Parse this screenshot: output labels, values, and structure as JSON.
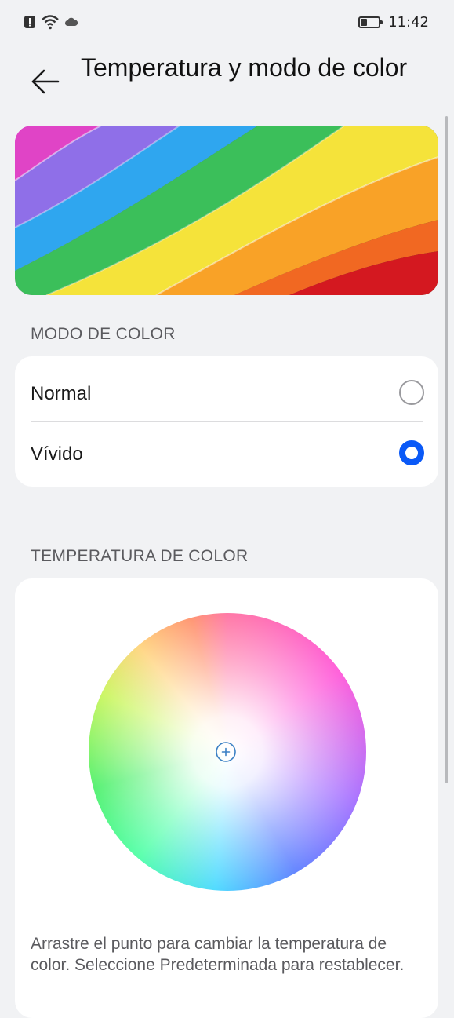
{
  "status_bar": {
    "time": "11:42",
    "battery_level": 0.35,
    "icons": [
      "alert-icon",
      "wifi-icon",
      "cloud-icon",
      "battery-icon"
    ]
  },
  "header": {
    "title": "Temperatura y modo de color",
    "back_icon": "back-arrow-icon"
  },
  "color_mode": {
    "section_title": "MODO DE COLOR",
    "options": [
      {
        "label": "Normal",
        "selected": false
      },
      {
        "label": "Vívido",
        "selected": true
      }
    ]
  },
  "color_temperature": {
    "section_title": "TEMPERATURA DE COLOR",
    "hint": "Arrastre el punto para cambiar la temperatura de color. Seleccione Predeterminada para restablecer."
  },
  "colors": {
    "accent": "#0a59f7",
    "background": "#f1f2f4",
    "card": "#ffffff",
    "secondary_text": "#5a5a5e"
  }
}
